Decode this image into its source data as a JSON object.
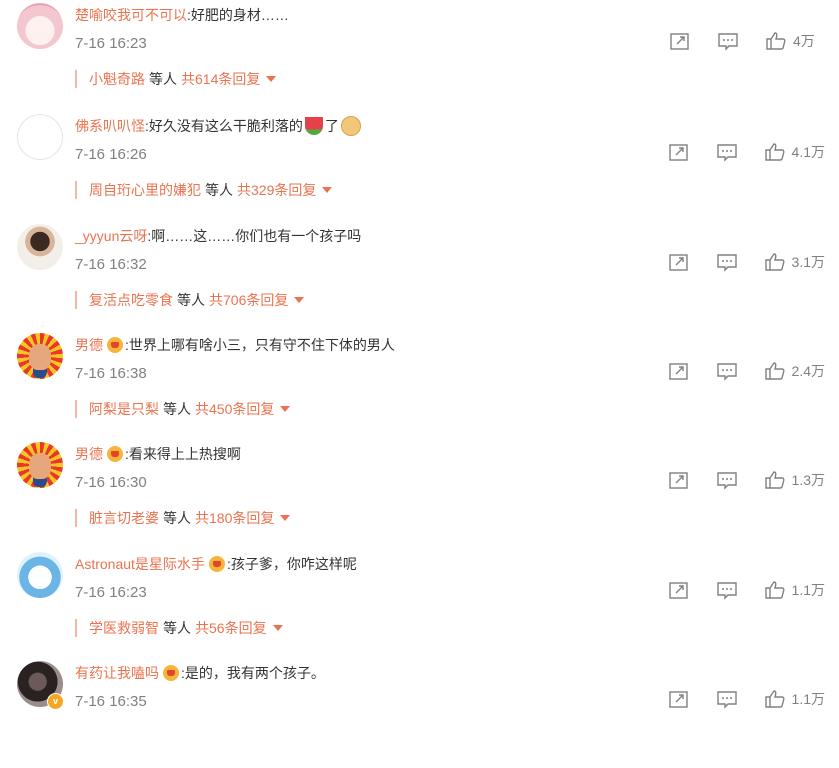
{
  "comments": [
    {
      "user": "楚喻咬我可不可以",
      "text": ":好肥的身材……",
      "time": "7-16 16:23",
      "likes": "4万",
      "reply_user": "小魁奇路",
      "reply_mid": "等人",
      "reply_total": "共614条回复"
    },
    {
      "user": "佛系叭叭怪",
      "text": ":好久没有这么干脆利落的",
      "text2": "了",
      "time": "7-16 16:26",
      "likes": "4.1万",
      "reply_user": "周自珩心里的嫌犯",
      "reply_mid": "等人",
      "reply_total": "共329条回复"
    },
    {
      "user": "_yyyun云呀",
      "text": ":啊……这……你们也有一个孩子吗",
      "time": "7-16 16:32",
      "likes": "3.1万",
      "reply_user": "复活点吃零食",
      "reply_mid": "等人",
      "reply_total": "共706条回复"
    },
    {
      "user": "男德",
      "text": ":世界上哪有啥小三，只有守不住下体的男人",
      "time": "7-16 16:38",
      "likes": "2.4万",
      "reply_user": "阿梨是只梨",
      "reply_mid": "等人",
      "reply_total": "共450条回复"
    },
    {
      "user": "男德",
      "text": ":看来得上上热搜啊",
      "time": "7-16 16:30",
      "likes": "1.3万",
      "reply_user": "脏言切老婆",
      "reply_mid": "等人",
      "reply_total": "共180条回复"
    },
    {
      "user": "Astronaut是星际水手",
      "text": ":孩子爹，你咋这样呢",
      "time": "7-16 16:23",
      "likes": "1.1万",
      "reply_user": "学医救弱智",
      "reply_mid": "等人",
      "reply_total": "共56条回复"
    },
    {
      "user": "有药让我嗑吗",
      "text": ":是的，我有两个孩子。",
      "time": "7-16 16:35",
      "likes": "1.1万",
      "verified_mark": "v"
    }
  ],
  "icons": {
    "share": "share-icon",
    "comment": "comment-icon",
    "like": "thumbs-up-icon",
    "expand": "caret-down-icon"
  },
  "colors": {
    "username": "#eb7350",
    "text": "#333333",
    "meta": "#808080"
  }
}
